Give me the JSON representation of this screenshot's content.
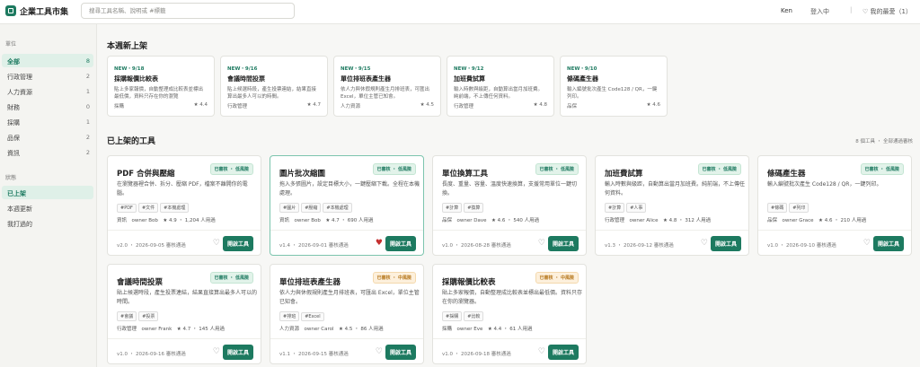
{
  "header": {
    "app_title": "企業工具市集",
    "search_placeholder": "搜尋工具名稱、說明或 #標籤",
    "user": "Ken",
    "login": "登入中",
    "separator": "|",
    "favorites": "♡ 我的最愛（1）"
  },
  "sidebar": {
    "unit_heading": "單位",
    "units": [
      {
        "label": "全部",
        "count": "8",
        "active": true
      },
      {
        "label": "行政管理",
        "count": "2"
      },
      {
        "label": "人力資源",
        "count": "1"
      },
      {
        "label": "財務",
        "count": "0"
      },
      {
        "label": "採購",
        "count": "1"
      },
      {
        "label": "品保",
        "count": "2"
      },
      {
        "label": "資訊",
        "count": "2"
      }
    ],
    "status_heading": "狀態",
    "statuses": [
      {
        "label": "已上架",
        "active": true
      },
      {
        "label": "本週更新"
      },
      {
        "label": "我打過的"
      }
    ]
  },
  "new_section": {
    "title": "本週新上架",
    "cards": [
      {
        "date": "NEW・9/18",
        "title": "採購報價比較表",
        "desc": "貼上多家報價，自動整理成比較表並標出最低價，資料只存在你的瀏覽",
        "unit": "採購",
        "rating": "★ 4.4"
      },
      {
        "date": "NEW・9/16",
        "title": "會議時間投票",
        "desc": "貼上候選時段，產生投票連結，結果直接算出最多人可以的時間。",
        "unit": "行政管理",
        "rating": "★ 4.7"
      },
      {
        "date": "NEW・9/15",
        "title": "單位排班表產生器",
        "desc": "依人力與休假規則產生月排班表，可匯出 Excel，單位主管已知會。",
        "unit": "人力資源",
        "rating": "★ 4.5"
      },
      {
        "date": "NEW・9/12",
        "title": "加班費試算",
        "desc": "輸入時數與級距，自動算出當月加班費。純前端，不上傳任何資料。",
        "unit": "行政管理",
        "rating": "★ 4.8"
      },
      {
        "date": "NEW・9/10",
        "title": "條碼產生器",
        "desc": "輸入編號批次產生 Code128 / QR，一鍵列印。",
        "unit": "品保",
        "rating": "★ 4.6"
      }
    ]
  },
  "tools_section": {
    "title": "已上架的工具",
    "count_text": "8 個工具 ・ 全部通過審核",
    "open_label": "開啟工具",
    "tools": [
      {
        "title": "PDF 合併與壓縮",
        "badge": "已審核 ・ 低風險",
        "risk": "low",
        "desc": "在瀏覽器裡合併、拆分、壓縮 PDF，檔案不離開你的電腦。",
        "tags": [
          "#PDF",
          "#文件",
          "#本機處理"
        ],
        "meta": "資訊　owner Bob　★ 4.9 ・ 1,204 人用過",
        "version": "v2.0 ・ 2026-09-05 審核通過",
        "heart": "♡",
        "fav": false
      },
      {
        "title": "圖片批次縮圖",
        "badge": "已審核 ・ 低風險",
        "risk": "low",
        "desc": "拖入多張圖片，設定目標大小，一鍵壓縮下載。全程在本機處理。",
        "tags": [
          "#圖片",
          "#壓縮",
          "#本機處理"
        ],
        "meta": "資訊　owner Bob　★ 4.7 ・ 690 人用過",
        "version": "v1.4 ・ 2026-09-01 審核通過",
        "heart": "♥",
        "fav": true
      },
      {
        "title": "單位換算工具",
        "badge": "已審核 ・ 低風險",
        "risk": "low",
        "desc": "長度、重量、容量、溫度快速換算，支援常用單位一鍵切換。",
        "tags": [
          "#計算",
          "#換算"
        ],
        "meta": "品保　owner Dave　★ 4.6 ・ 540 人用過",
        "version": "v1.0 ・ 2026-08-28 審核通過",
        "heart": "♡",
        "fav": false
      },
      {
        "title": "加班費試算",
        "badge": "已審核 ・ 低風險",
        "risk": "low",
        "desc": "輸入時數與級距，自動算出當月加班費。純前端，不上傳任何資料。",
        "tags": [
          "#計算",
          "#人事"
        ],
        "meta": "行政管理　owner Alice　★ 4.8 ・ 312 人用過",
        "version": "v1.3 ・ 2026-09-12 審核通過",
        "heart": "♡",
        "fav": false
      },
      {
        "title": "條碼產生器",
        "badge": "已審核 ・ 低風險",
        "risk": "low",
        "desc": "輸入編號批次產生 Code128 / QR，一鍵列印。",
        "tags": [
          "#條碼",
          "#列印"
        ],
        "meta": "品保　owner Grace　★ 4.6 ・ 210 人用過",
        "version": "v1.0 ・ 2026-09-10 審核通過",
        "heart": "♡",
        "fav": false
      },
      {
        "title": "會議時間投票",
        "badge": "已審核 ・ 低風險",
        "risk": "low",
        "desc": "貼上候選時段，產生投票連結，結果直接算出最多人可以的時間。",
        "tags": [
          "#會議",
          "#投票"
        ],
        "meta": "行政管理　owner Frank　★ 4.7 ・ 145 人用過",
        "version": "v1.0 ・ 2026-09-16 審核通過",
        "heart": "♡",
        "fav": false
      },
      {
        "title": "單位排班表產生器",
        "badge": "已審核 ・ 中風險",
        "risk": "mid",
        "desc": "依人力與休假規則產生月排班表，可匯出 Excel，單位主管已知會。",
        "tags": [
          "#排班",
          "#Excel"
        ],
        "meta": "人力資源　owner Carol　★ 4.5 ・ 86 人用過",
        "version": "v1.1 ・ 2026-09-15 審核通過",
        "heart": "♡",
        "fav": false
      },
      {
        "title": "採購報價比較表",
        "badge": "已審核 ・ 中風險",
        "risk": "mid",
        "desc": "貼上多家報價，自動整理成比較表並標出最低價。資料只存在你的瀏覽器。",
        "tags": [
          "#採購",
          "#比較"
        ],
        "meta": "採購　owner Eve　★ 4.4 ・ 61 人用過",
        "version": "v1.0 ・ 2026-09-18 審核通過",
        "heart": "♡",
        "fav": false
      }
    ]
  },
  "colors": {
    "accent": "#1d7a60",
    "low_badge_bg": "#e2f3ea",
    "mid_badge_bg": "#fdf0dc",
    "heart_on": "#c53030"
  }
}
